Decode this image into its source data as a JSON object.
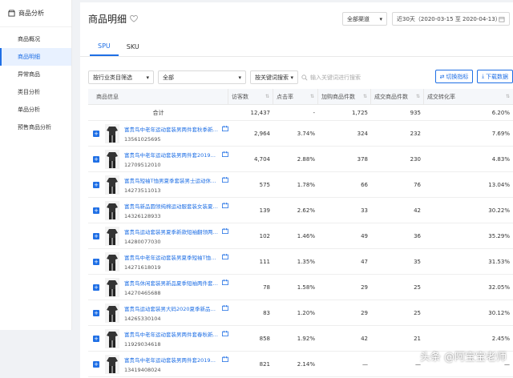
{
  "sidebar": {
    "header": "商品分析",
    "items": [
      "商品概况",
      "商品明细",
      "异常商品",
      "类目分析",
      "单品分析",
      "预售商品分析"
    ],
    "active_index": 1
  },
  "header": {
    "title": "商品明细",
    "channel": "全部渠道",
    "date_range": "近30天（2020-03-15 至 2020-04-13）"
  },
  "tabs": [
    "SPU",
    "SKU"
  ],
  "filters": {
    "category_filter": "按行业类目筛选",
    "category_value": "全部",
    "keyword_mode": "按关键词搜索",
    "search_placeholder": "输入关键词进行搜索",
    "switch_metrics": "切换指标",
    "download": "下载数据"
  },
  "table": {
    "columns": [
      "商品信息",
      "访客数",
      "点击率",
      "加购商品件数",
      "成交商品件数",
      "成交转化率"
    ],
    "total": {
      "label": "合计",
      "values": [
        "12,437",
        "-",
        "1,725",
        "935",
        "6.20%"
      ]
    },
    "rows": [
      {
        "name": "富贵鸟中老年运动套装男两件套秋季新品…",
        "id": "13561025695",
        "values": [
          "2,964",
          "3.74%",
          "324",
          "232",
          "7.69%"
        ]
      },
      {
        "name": "富贵鸟中老年运动套装男两件套2019春秋…",
        "id": "12709512010",
        "values": [
          "4,704",
          "2.88%",
          "378",
          "230",
          "4.83%"
        ]
      },
      {
        "name": "富贵鸟短袖T恤男夏季套装男士运动休闲…",
        "id": "14273511013",
        "values": [
          "575",
          "1.78%",
          "66",
          "76",
          "13.04%"
        ]
      },
      {
        "name": "富贵鸟新品圆领纯棉运动服套装女装夏季…",
        "id": "14326128933",
        "values": [
          "139",
          "2.62%",
          "33",
          "42",
          "30.22%"
        ]
      },
      {
        "name": "富贵鸟运动套装男夏季新款短袖翻领两件…",
        "id": "14280077030",
        "values": [
          "102",
          "1.46%",
          "49",
          "36",
          "35.29%"
        ]
      },
      {
        "name": "富贵鸟中老年运动套装男夏季短袖T恤短…",
        "id": "14271618019",
        "values": [
          "111",
          "1.35%",
          "47",
          "35",
          "31.53%"
        ]
      },
      {
        "name": "富贵鸟休闲套装男新品夏季短袖两件套运…",
        "id": "14270465688",
        "values": [
          "78",
          "1.58%",
          "29",
          "25",
          "32.05%"
        ]
      },
      {
        "name": "富贵鸟运动套装男大码2020夏季新品短袖…",
        "id": "14265330104",
        "values": [
          "83",
          "1.20%",
          "29",
          "25",
          "30.12%"
        ]
      },
      {
        "name": "富贵鸟中老年运动套装男两件套春秋新品…",
        "id": "11929034618",
        "values": [
          "858",
          "1.92%",
          "42",
          "21",
          "2.45%"
        ]
      },
      {
        "name": "富贵鸟中老年运动套装男两件套2019秋冬…",
        "id": "13419408024",
        "values": [
          "821",
          "2.14%",
          "—",
          "—",
          "—"
        ]
      }
    ]
  },
  "watermark": "头条 @阿宝宝老师",
  "colors": {
    "accent": "#1f6fe5",
    "header_bg": "#f5f7fa"
  }
}
